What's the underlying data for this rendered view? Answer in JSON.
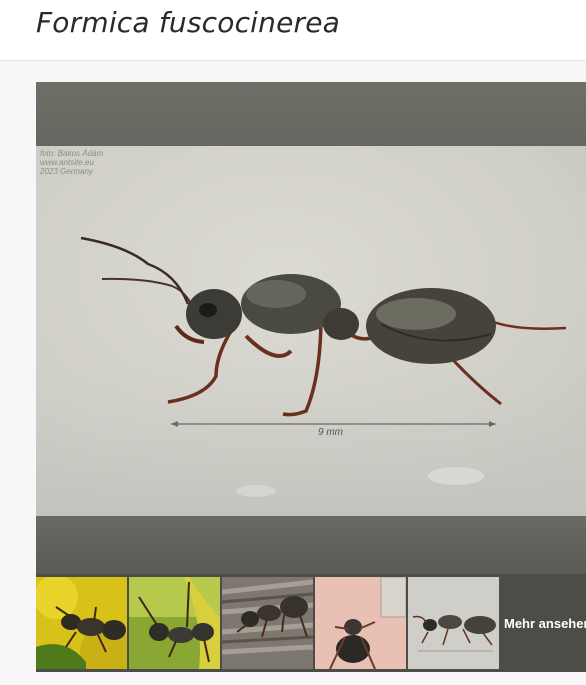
{
  "page": {
    "title": "Formica fuscocinerea"
  },
  "main_image": {
    "credit_lines": [
      "foto: Bakos Ádám",
      "www.antsite.eu",
      "2023 Germany"
    ],
    "scale_label": "9 mm"
  },
  "thumbnails": [
    {
      "icon": "ant-on-yellow-flower-photo"
    },
    {
      "icon": "ant-on-green-leaf-photo"
    },
    {
      "icon": "ant-on-wood-photo"
    },
    {
      "icon": "ant-on-pink-background-photo"
    },
    {
      "icon": "ant-side-view-photo"
    }
  ],
  "more_link": "Mehr ansehen"
}
